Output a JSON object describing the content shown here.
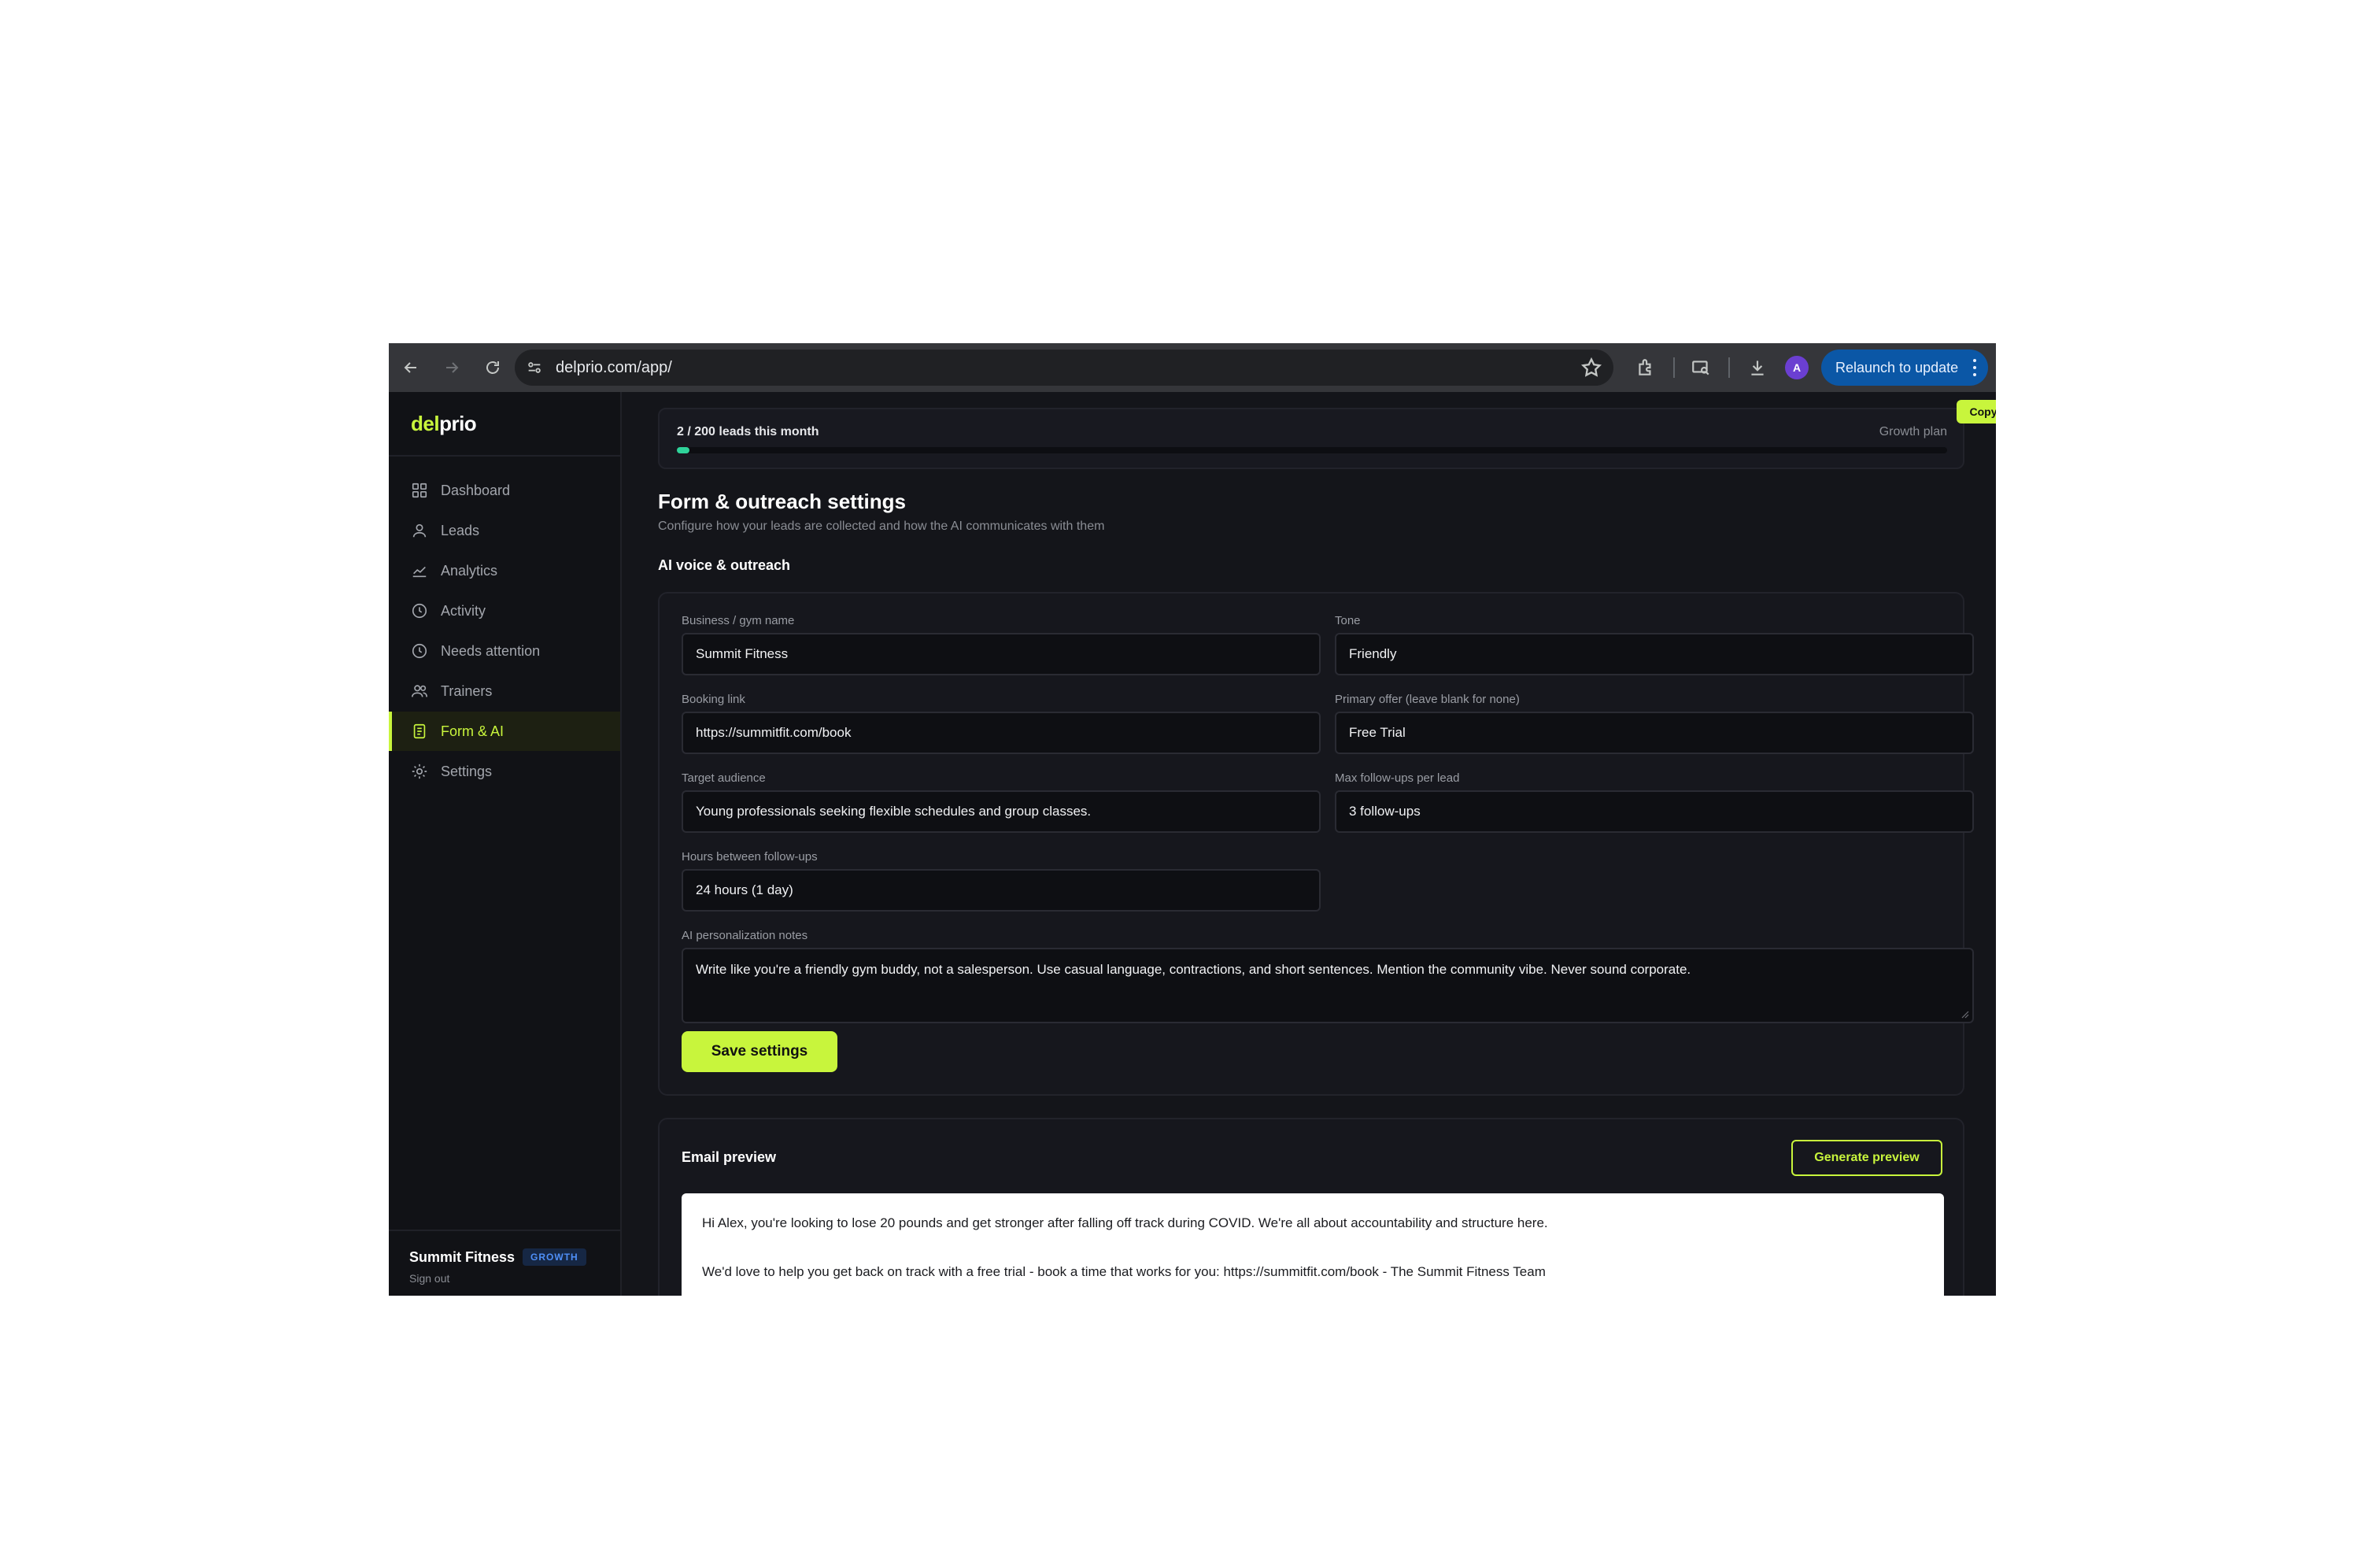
{
  "browser": {
    "url": "delprio.com/app/",
    "profile_initial": "A",
    "relaunch_label": "Relaunch to update"
  },
  "brand": {
    "part1": "del",
    "part2": "prio"
  },
  "sidebar": {
    "items": [
      {
        "label": "Dashboard",
        "icon": "grid-icon"
      },
      {
        "label": "Leads",
        "icon": "user-icon"
      },
      {
        "label": "Analytics",
        "icon": "chart-line-icon"
      },
      {
        "label": "Activity",
        "icon": "clock-icon"
      },
      {
        "label": "Needs attention",
        "icon": "clock-alert-icon"
      },
      {
        "label": "Trainers",
        "icon": "users-icon"
      },
      {
        "label": "Form & AI",
        "icon": "document-icon",
        "active": true
      },
      {
        "label": "Settings",
        "icon": "sun-gear-icon"
      }
    ],
    "account_name": "Summit Fitness",
    "plan_badge": "GROWTH",
    "sign_out": "Sign out"
  },
  "usage": {
    "label": "2 / 200 leads this month",
    "plan": "Growth plan",
    "used": 2,
    "limit": 200,
    "copy_label": "Copy"
  },
  "page": {
    "title": "Form & outreach settings",
    "subtitle": "Configure how your leads are collected and how the AI communicates with them",
    "section": "AI voice & outreach"
  },
  "form": {
    "business_label": "Business / gym name",
    "business_value": "Summit Fitness",
    "tone_label": "Tone",
    "tone_value": "Friendly",
    "booking_label": "Booking link",
    "booking_value": "https://summitfit.com/book",
    "offer_label": "Primary offer (leave blank for none)",
    "offer_value": "Free Trial",
    "audience_label": "Target audience",
    "audience_value": "Young professionals seeking flexible schedules and group classes.",
    "followups_label": "Max follow-ups per lead",
    "followups_value": "3 follow-ups",
    "hours_label": "Hours between follow-ups",
    "hours_value": "24 hours (1 day)",
    "notes_label": "AI personalization notes",
    "notes_value": "Write like you're a friendly gym buddy, not a salesperson. Use casual language, contractions, and short sentences. Mention the community vibe. Never sound corporate.",
    "save_label": "Save settings"
  },
  "preview": {
    "title": "Email preview",
    "generate_label": "Generate preview",
    "para1": "Hi Alex, you're looking to lose 20 pounds and get stronger after falling off track during COVID. We're all about accountability and structure here.",
    "para2": "We'd love to help you get back on track with a free trial - book a time that works for you: https://summitfit.com/book - The Summit Fitness Team"
  },
  "colors": {
    "accent": "#c8f53c",
    "background": "#14151a",
    "progress": "#2fd39a",
    "badge": "#4f8ff7"
  }
}
